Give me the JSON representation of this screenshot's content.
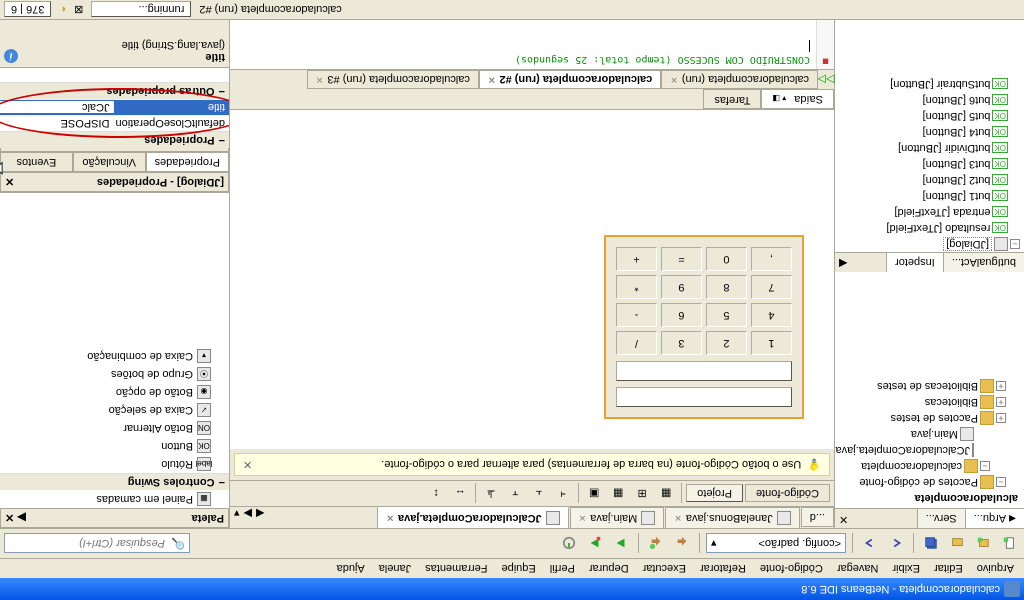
{
  "titlebar": {
    "text": "calculadoracompleta - NetBeans IDE 6.8"
  },
  "menu": {
    "items": [
      "Arquivo",
      "Editar",
      "Exibir",
      "Navegar",
      "Código-fonte",
      "Refatorar",
      "Executar",
      "Depurar",
      "Perfil",
      "Equipe",
      "Ferramentas",
      "Janela",
      "Ajuda"
    ]
  },
  "toolbar": {
    "config_select": "<config. padrão>",
    "search_placeholder": "Pesquisar (Ctrl+I)"
  },
  "left_panel": {
    "tabs": [
      "Arqu...",
      "Serv..."
    ],
    "project_name": "alculadoracompleta",
    "nodes": [
      "Pacotes de código-fonte",
      "calculadoracompleta",
      "JCalculadoraCompleta.java",
      "Main.java",
      "Pacotes de testes",
      "Bibliotecas",
      "Bibliotecas de testes"
    ]
  },
  "inspector": {
    "tabs": [
      "butIgualAct...",
      "Inspetor"
    ],
    "root": "[JDialog]",
    "items": [
      "resultado [JTextField]",
      "entrada [JTextField]",
      "but1 [JButton]",
      "but2 [JButton]",
      "but3 [JButton]",
      "butDividir [JButton]",
      "but4 [JButton]",
      "but5 [JButton]",
      "but6 [JButton]",
      "butSubtrair [JButton]"
    ]
  },
  "editor": {
    "tabs": [
      {
        "name": "...d",
        "active": false
      },
      {
        "name": "JanelaBonus.java",
        "active": false
      },
      {
        "name": "Main.java",
        "active": false
      },
      {
        "name": "JCalculadoraCompleta.java",
        "active": true
      }
    ],
    "view_source": "Código-fonte",
    "view_design": "Projeto",
    "hint": "Use o botão Código-fonte (na barra de ferramentas) para alternar para o código-fonte."
  },
  "calc": {
    "buttons": [
      "1",
      "2",
      "3",
      "/",
      "4",
      "5",
      "6",
      "-",
      "7",
      "8",
      "9",
      "*",
      ",",
      "0",
      "=",
      "+"
    ]
  },
  "output": {
    "saida": "Saída",
    "tarefas": "Tarefas",
    "tabs": [
      "calculadoracompleta (run)",
      "calculadoracompleta (run) #2",
      "calculadoracompleta (run) #3"
    ],
    "text": "CONSTRUÍDO COM SUCESSO (tempo total: 25 segundos)"
  },
  "palette": {
    "title": "Paleta",
    "groups": {
      "containers": "Painel em camadas",
      "swing": "Controles Swing"
    },
    "items": [
      "Rótulo",
      "Button",
      "Botão Alternar",
      "Caixa de seleção",
      "Botão de opção",
      "Grupo de botões",
      "Caixa de combinação"
    ],
    "icon_text": {
      "rotulo": "label",
      "button": "OK",
      "toggle": "ON",
      "check": "✓",
      "radio": "◉",
      "group": "⦿",
      "combo": "▾"
    }
  },
  "properties": {
    "title": "[JDialog] - Propriedades",
    "tabs": [
      "Propriedades",
      "Vinculação",
      "Eventos",
      "Código"
    ],
    "group1": "Propriedades",
    "rows": [
      {
        "key": "defaultCloseOperation",
        "val": "DISPOSE"
      },
      {
        "key": "title",
        "val": "JCalc",
        "selected": true
      }
    ],
    "group2": "Outras propriedades",
    "desc_title": "title",
    "desc_body": "(java.lang.String) title"
  },
  "status": {
    "task": "calculadoracompleta (run) #2",
    "state": "running...",
    "pos": "376 | 6"
  }
}
